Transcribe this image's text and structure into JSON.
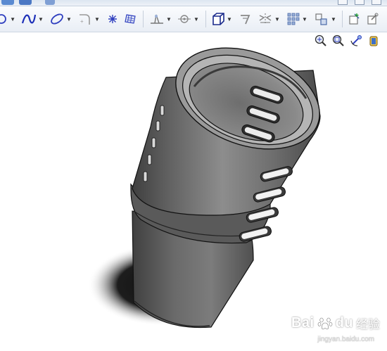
{
  "toolbar": {
    "items": [
      {
        "name": "circle-tool",
        "icon": "circle-icon",
        "dropdown": true
      },
      {
        "name": "spline-tool",
        "icon": "spline-icon",
        "dropdown": true
      },
      {
        "name": "ellipse-tool",
        "icon": "ellipse-icon",
        "dropdown": true
      },
      {
        "name": "fillet-tool",
        "icon": "sketch-fillet-icon",
        "dropdown": true
      },
      {
        "name": "point-tool",
        "icon": "point-icon",
        "dropdown": false
      },
      {
        "name": "plane-tool",
        "icon": "plane-icon",
        "dropdown": false
      },
      {
        "name": "trim-tool",
        "icon": "trim-icon",
        "dropdown": true
      },
      {
        "name": "offset-tool",
        "icon": "offset-icon",
        "dropdown": true
      },
      {
        "name": "display-style-tool",
        "icon": "cube-icon",
        "dropdown": true
      },
      {
        "name": "convert-tool",
        "icon": "convert-entities-icon",
        "dropdown": false
      },
      {
        "name": "mirror-tool",
        "icon": "mirror-icon",
        "dropdown": true
      },
      {
        "name": "pattern-tool",
        "icon": "linear-pattern-icon",
        "dropdown": true
      },
      {
        "name": "move-tool",
        "icon": "move-entities-icon",
        "dropdown": true
      },
      {
        "name": "relations-tool",
        "icon": "add-relation-icon",
        "dropdown": false
      },
      {
        "name": "repair-tool",
        "icon": "repair-sketch-icon",
        "dropdown": false
      }
    ]
  },
  "viewbar": {
    "items": [
      "zoom-to-fit-icon",
      "zoom-to-area-icon",
      "rotate-view-icon",
      "section-view-icon"
    ]
  },
  "colors": {
    "accent": "#2f3fbf",
    "toolbar_bg": "#eef2f8",
    "model": "#6b6b6b"
  },
  "watermark": {
    "brand": "Bai",
    "brand2": "du",
    "cn": "经验",
    "url": "jingyan.baidu.com"
  }
}
